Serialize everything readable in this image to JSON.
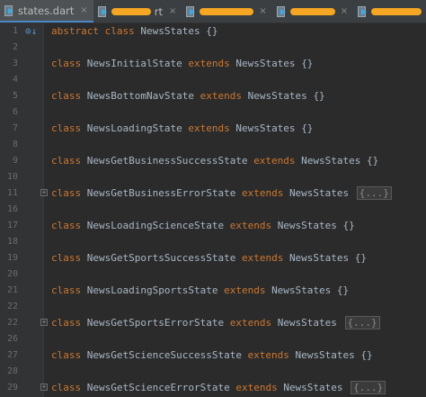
{
  "tabs": [
    {
      "label": "states.dart",
      "active": true,
      "redacted": false,
      "icon": "dart-file-icon"
    },
    {
      "label": "rt",
      "active": false,
      "redacted": true,
      "icon": "dart-file-icon"
    },
    {
      "label": "",
      "active": false,
      "redacted": true,
      "icon": "dart-file-icon"
    },
    {
      "label": "",
      "active": false,
      "redacted": true,
      "icon": "dart-file-icon"
    },
    {
      "label": "",
      "active": false,
      "redacted": true,
      "icon": "dart-file-icon"
    }
  ],
  "close_glyph": "×",
  "colors": {
    "background": "#2b2b2b",
    "keyword": "#cc7832",
    "text": "#a9b7c6",
    "line_number": "#6c6c6c",
    "redaction": "#f5a623",
    "active_tab_underline": "#4a88c7"
  },
  "lines": [
    {
      "num": "1",
      "kw1": "abstract class",
      "name": "NewsStates",
      "kw2": "",
      "parent": "",
      "body": "{}",
      "fold": false,
      "impl_icon": true
    },
    {
      "num": "2",
      "blank": true
    },
    {
      "num": "3",
      "kw1": "class",
      "name": "NewsInitialState",
      "kw2": "extends",
      "parent": "NewsStates",
      "body": "{}",
      "fold": false
    },
    {
      "num": "4",
      "blank": true
    },
    {
      "num": "5",
      "kw1": "class",
      "name": "NewsBottomNavState",
      "kw2": "extends",
      "parent": "NewsStates",
      "body": "{}",
      "fold": false
    },
    {
      "num": "6",
      "blank": true
    },
    {
      "num": "7",
      "kw1": "class",
      "name": "NewsLoadingState",
      "kw2": "extends",
      "parent": "NewsStates",
      "body": "{}",
      "fold": false
    },
    {
      "num": "8",
      "blank": true
    },
    {
      "num": "9",
      "kw1": "class",
      "name": "NewsGetBusinessSuccessState",
      "kw2": "extends",
      "parent": "NewsStates",
      "body": "{}",
      "fold": false
    },
    {
      "num": "10",
      "blank": true
    },
    {
      "num": "11",
      "kw1": "class",
      "name": "NewsGetBusinessErrorState",
      "kw2": "extends",
      "parent": "NewsStates",
      "body": "{...}",
      "fold": true
    },
    {
      "num": "16",
      "blank": true
    },
    {
      "num": "17",
      "kw1": "class",
      "name": "NewsLoadingScienceState",
      "kw2": "extends",
      "parent": "NewsStates",
      "body": "{}",
      "fold": false
    },
    {
      "num": "18",
      "blank": true
    },
    {
      "num": "19",
      "kw1": "class",
      "name": "NewsGetSportsSuccessState",
      "kw2": "extends",
      "parent": "NewsStates",
      "body": "{}",
      "fold": false
    },
    {
      "num": "20",
      "blank": true
    },
    {
      "num": "21",
      "kw1": "class",
      "name": "NewsLoadingSportsState",
      "kw2": "extends",
      "parent": "NewsStates",
      "body": "{}",
      "fold": false
    },
    {
      "num": "22",
      "blank": true
    },
    {
      "num": "22",
      "kw1": "class",
      "name": "NewsGetSportsErrorState",
      "kw2": "extends",
      "parent": "NewsStates",
      "body": "{...}",
      "fold": true
    },
    {
      "num": "26",
      "blank": true
    },
    {
      "num": "27",
      "kw1": "class",
      "name": "NewsGetScienceSuccessState",
      "kw2": "extends",
      "parent": "NewsStates",
      "body": "{}",
      "fold": false
    },
    {
      "num": "28",
      "blank": true
    },
    {
      "num": "29",
      "kw1": "class",
      "name": "NewsGetScienceErrorState",
      "kw2": "extends",
      "parent": "NewsStates",
      "body": "{...}",
      "fold": true
    }
  ]
}
